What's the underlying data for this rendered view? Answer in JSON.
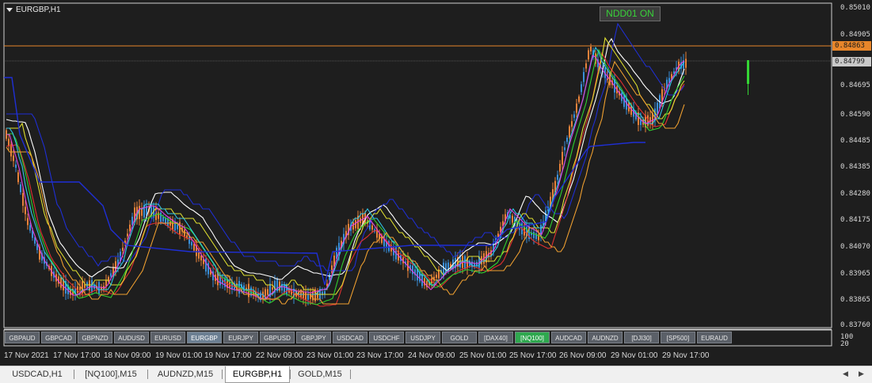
{
  "chart": {
    "symbol_title": "EURGBP,H1",
    "indicator_badge": "NDD01 ON",
    "price_axis": [
      "0.85010",
      "0.84905",
      "0.84695",
      "0.84590",
      "0.84485",
      "0.84385",
      "0.84280",
      "0.84175",
      "0.84070",
      "0.83965",
      "0.83865",
      "0.83760"
    ],
    "horizontal_line_price": "0.84863",
    "current_price": "0.84799",
    "sub_axis": [
      "100",
      "20"
    ],
    "time_axis": [
      "17 Nov 2021",
      "17 Nov 17:00",
      "18 Nov 09:00",
      "19 Nov 01:00",
      "19 Nov 17:00",
      "22 Nov 09:00",
      "23 Nov 01:00",
      "23 Nov 17:00",
      "24 Nov 09:00",
      "25 Nov 01:00",
      "25 Nov 17:00",
      "26 Nov 09:00",
      "29 Nov 01:00",
      "29 Nov 17:00"
    ],
    "colors": {
      "background": "#1e1e1e",
      "hline": "#e8862a",
      "badge_text": "#39d239",
      "candle_up": "#3a8fd8",
      "candle_down": "#e8823a"
    }
  },
  "symbol_buttons": [
    "GBPAUD",
    "GBPCAD",
    "GBPNZD",
    "AUDUSD",
    "EURUSD",
    "EURGBP",
    "EURJPY",
    "GBPUSD",
    "GBPJPY",
    "USDCAD",
    "USDCHF",
    "USDJPY",
    "GOLD",
    "[DAX40]",
    "[NQ100]",
    "AUDCAD",
    "AUDNZD",
    "[DJI30]",
    "[SP500]",
    "EURAUD"
  ],
  "active_symbol": "EURGBP",
  "highlighted_symbol": "[NQ100]",
  "window_tabs": [
    "USDCAD,H1",
    "[NQ100],M15",
    "AUDNZD,M15",
    "EURGBP,H1",
    "GOLD,M15"
  ],
  "active_tab": "EURGBP,H1"
}
